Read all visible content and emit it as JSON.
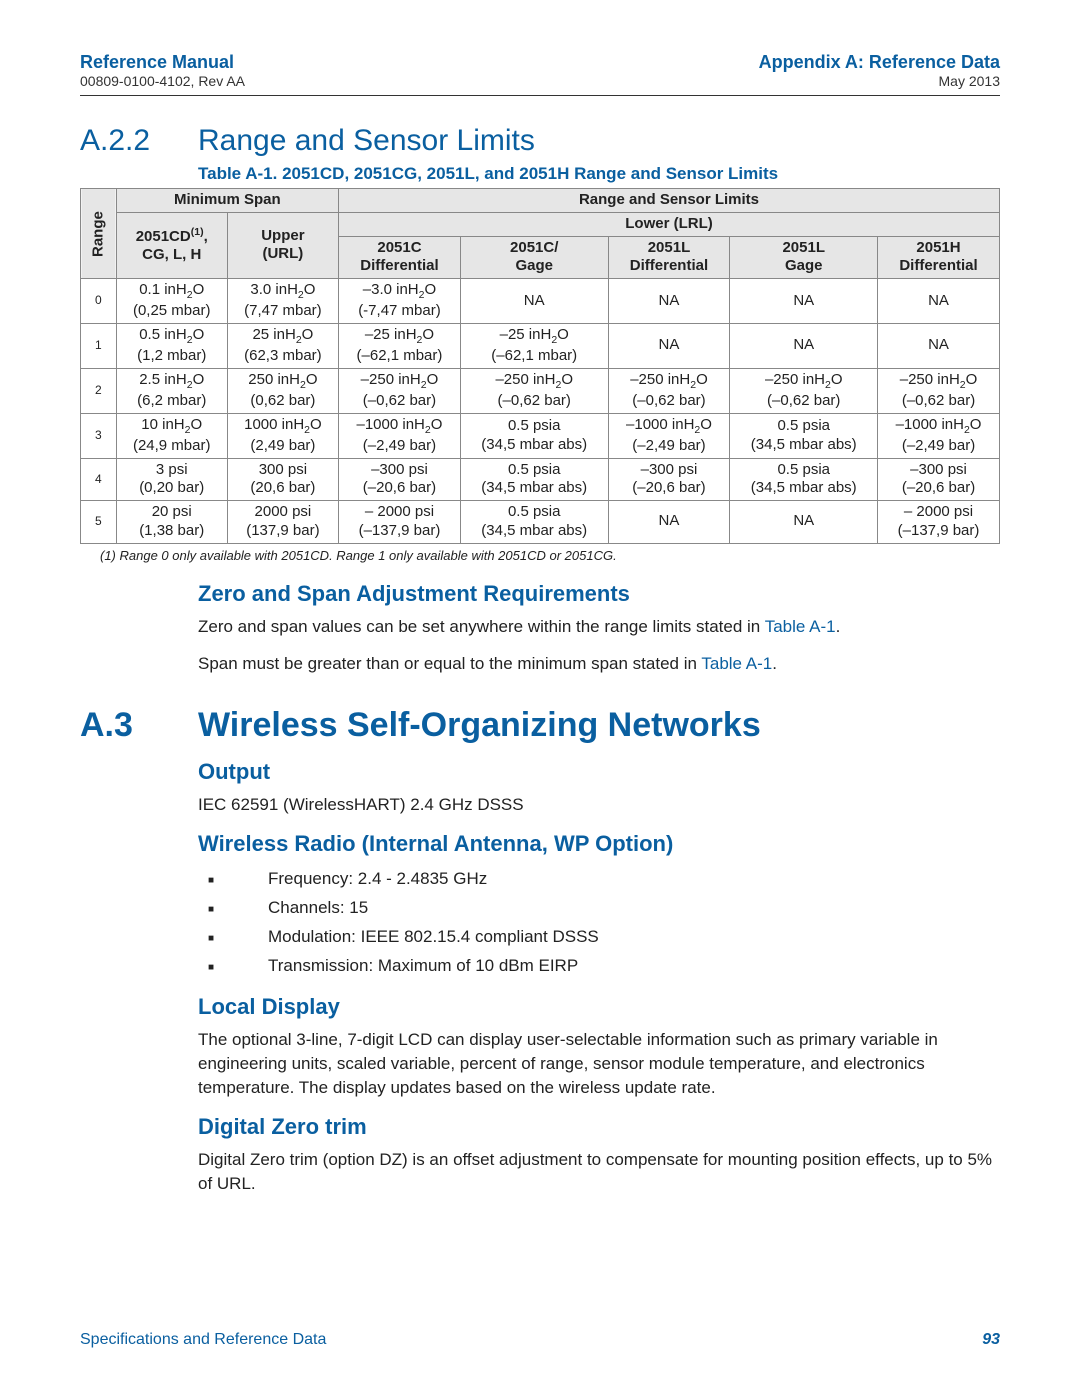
{
  "header": {
    "left_title": "Reference Manual",
    "left_sub": "00809-0100-4102, Rev AA",
    "right_title": "Appendix A: Reference Data",
    "right_sub": "May 2013"
  },
  "section_a22": {
    "num": "A.2.2",
    "title": "Range and Sensor Limits",
    "caption": "Table A-1.  2051CD, 2051CG, 2051L, and 2051H Range and Sensor Limits",
    "col_range": "Range",
    "col_minspan": "Minimum Span",
    "col_rsl": "Range and Sensor Limits",
    "col_lower": "Lower (LRL)",
    "col_2051cd_top": "2051CD",
    "col_2051cd_sup": "(1)",
    "col_2051cd_bot": "CG, L, H",
    "col_upper_top": "Upper",
    "col_upper_bot": "(URL)",
    "col_c_diff_top": "2051C",
    "col_c_diff_bot": "Differential",
    "col_c_gage_top": "2051C/",
    "col_c_gage_bot": "Gage",
    "col_l_diff_top": "2051L",
    "col_l_diff_bot": "Differential",
    "col_l_gage_top": "2051L",
    "col_l_gage_bot": "Gage",
    "col_h_diff_top": "2051H",
    "col_h_diff_bot": "Differential",
    "rows": [
      {
        "idx": "0",
        "minspan": "0.1 inH₂O\n(0,25 mbar)",
        "url": "3.0 inH₂O\n(7,47 mbar)",
        "c_diff": "–3.0 inH₂O\n(-7,47 mbar)",
        "c_gage": "NA",
        "l_diff": "NA",
        "l_gage": "NA",
        "h_diff": "NA"
      },
      {
        "idx": "1",
        "minspan": "0.5 inH₂O\n(1,2 mbar)",
        "url": "25 inH₂O\n(62,3 mbar)",
        "c_diff": "–25 inH₂O\n(–62,1 mbar)",
        "c_gage": "–25 inH₂O\n(–62,1 mbar)",
        "l_diff": "NA",
        "l_gage": "NA",
        "h_diff": "NA"
      },
      {
        "idx": "2",
        "minspan": "2.5 inH₂O\n(6,2 mbar)",
        "url": "250 inH₂O\n(0,62 bar)",
        "c_diff": "–250 inH₂O\n(–0,62 bar)",
        "c_gage": "–250 inH₂O\n(–0,62 bar)",
        "l_diff": "–250 inH₂O\n(–0,62 bar)",
        "l_gage": "–250 inH₂O\n(–0,62 bar)",
        "h_diff": "–250 inH₂O\n(–0,62 bar)"
      },
      {
        "idx": "3",
        "minspan": "10 inH₂O\n(24,9 mbar)",
        "url": "1000 inH₂O\n(2,49 bar)",
        "c_diff": "–1000 inH₂O\n(–2,49 bar)",
        "c_gage": "0.5 psia\n(34,5 mbar abs)",
        "l_diff": "–1000 inH₂O\n(–2,49 bar)",
        "l_gage": "0.5 psia\n(34,5 mbar abs)",
        "h_diff": "–1000 inH₂O\n(–2,49 bar)"
      },
      {
        "idx": "4",
        "minspan": "3 psi\n(0,20 bar)",
        "url": "300 psi\n(20,6 bar)",
        "c_diff": "–300 psi\n(–20,6 bar)",
        "c_gage": "0.5 psia\n(34,5 mbar abs)",
        "l_diff": "–300 psi\n(–20,6 bar)",
        "l_gage": "0.5  psia\n(34,5 mbar abs)",
        "h_diff": "–300 psi\n(–20,6 bar)"
      },
      {
        "idx": "5",
        "minspan": "20 psi\n(1,38 bar)",
        "url": "2000 psi\n(137,9 bar)",
        "c_diff": "– 2000 psi\n(–137,9 bar)",
        "c_gage": "0.5 psia\n(34,5 mbar abs)",
        "l_diff": "NA",
        "l_gage": "NA",
        "h_diff": "– 2000 psi\n(–137,9 bar)"
      }
    ],
    "footnote": "(1)  Range 0 only available with 2051CD. Range 1 only available with 2051CD or 2051CG."
  },
  "zero_span": {
    "title": "Zero and Span Adjustment Requirements",
    "p1a": "Zero and span values can be set anywhere within the range limits stated in ",
    "p1b": "Table A-1",
    "p1c": ".",
    "p2a": "Span must be greater than or equal to the minimum span stated in ",
    "p2b": "Table A-1",
    "p2c": "."
  },
  "section_a3": {
    "num": "A.3",
    "title": "Wireless Self-Organizing Networks"
  },
  "output": {
    "title": "Output",
    "p": "IEC 62591 (WirelessHART) 2.4 GHz DSSS"
  },
  "wireless_radio": {
    "title": "Wireless Radio (Internal Antenna, WP Option)",
    "li1": "Frequency: 2.4 - 2.4835 GHz",
    "li2": "Channels: 15",
    "li3": "Modulation: IEEE 802.15.4 compliant DSSS",
    "li4": "Transmission: Maximum of 10 dBm EIRP"
  },
  "local_display": {
    "title": "Local Display",
    "p": "The optional 3-line, 7-digit LCD can display user-selectable information such as primary variable in engineering units, scaled variable, percent of range, sensor module temperature, and electronics temperature. The display updates based on the wireless update rate."
  },
  "digital_zero": {
    "title": "Digital Zero trim",
    "p": "Digital Zero trim (option DZ) is an offset adjustment to compensate for mounting position effects, up to 5% of URL."
  },
  "footer": {
    "left": "Specifications and Reference Data",
    "right": "93"
  }
}
